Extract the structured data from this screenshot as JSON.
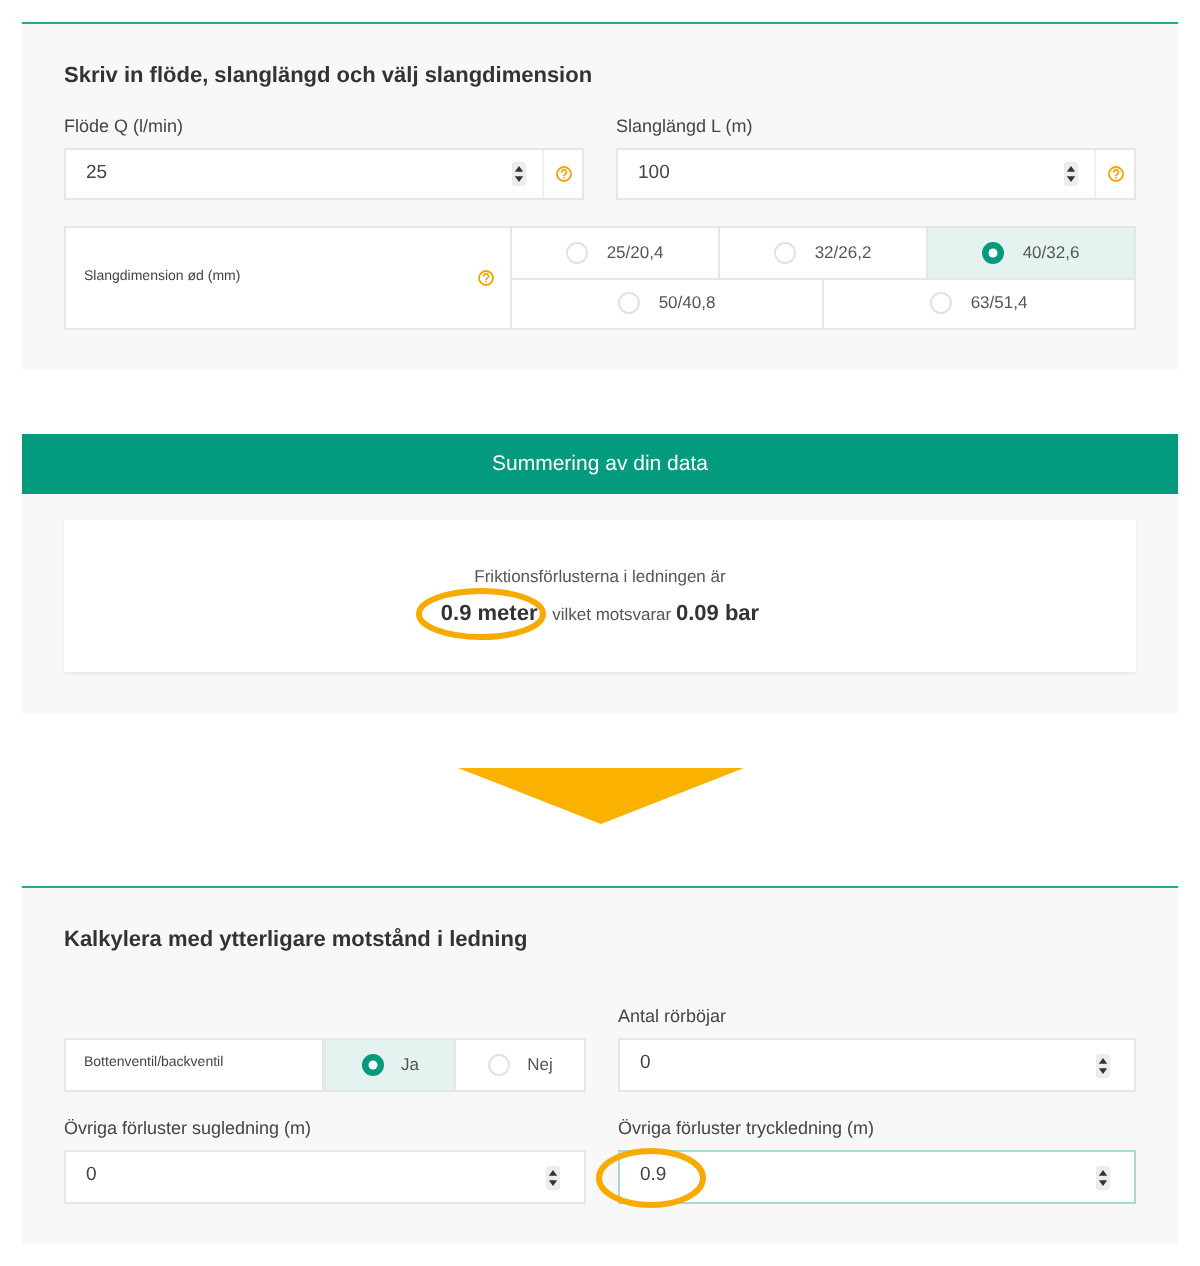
{
  "input_section": {
    "title": "Skriv in flöde, slanglängd och välj slangdimension",
    "fields": [
      {
        "label": "Flöde Q (l/min)",
        "value": "25",
        "help": true,
        "focused": false,
        "highlighted": false
      },
      {
        "label": "Slanglängd L (m)",
        "value": "100",
        "help": true,
        "focused": false,
        "highlighted": false
      }
    ],
    "dimension": {
      "label": "Slangdimension ød (mm)",
      "help": true,
      "options": [
        {
          "label": "25/20,4",
          "selected": false
        },
        {
          "label": "32/26,2",
          "selected": false
        },
        {
          "label": "40/32,6",
          "selected": true
        },
        {
          "label": "50/40,8",
          "selected": false
        },
        {
          "label": "63/51,4",
          "selected": false
        }
      ]
    }
  },
  "summary": {
    "title": "Summering av din data",
    "text": "Friktionsförlusterna i ledningen är\n**0.9 meter** vilket motsvarar **0.09 bar**",
    "highlighted": true
  },
  "additional_section": {
    "title": "Kalkylera med ytterligare motstånd i ledning",
    "valve": {
      "label": "Bottenventil/backventil",
      "options": [
        {
          "label": "Ja",
          "selected": true
        },
        {
          "label": "Nej",
          "selected": false
        }
      ]
    },
    "fields": [
      {
        "label": "Antal rörböjar",
        "value": "0",
        "help": false,
        "focused": false,
        "highlighted": false
      },
      {
        "label": "Övriga förluster sugledning (m)",
        "value": "0",
        "help": false,
        "focused": false,
        "highlighted": false
      },
      {
        "label": "Övriga förluster tryckledning (m)",
        "value": "0.9",
        "help": false,
        "focused": true,
        "highlighted": true
      }
    ]
  }
}
